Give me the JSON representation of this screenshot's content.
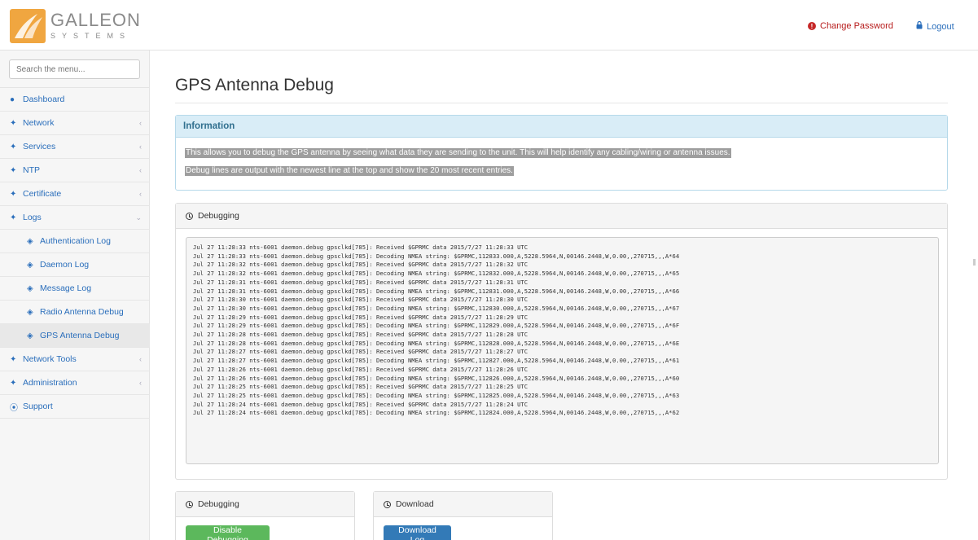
{
  "header": {
    "logo_name": "GALLEON",
    "logo_sub": "SYSTEMS",
    "change_password": "Change Password",
    "logout": "Logout",
    "brand_colors": {
      "logo_orange": "#f0a640",
      "link_blue": "#2a6ebb",
      "alert_red": "#c62828"
    }
  },
  "sidebar": {
    "search_placeholder": "Search the menu...",
    "items": [
      {
        "label": "Dashboard",
        "icon": "dashboard-icon"
      },
      {
        "label": "Network",
        "icon": "wrench-icon"
      },
      {
        "label": "Services",
        "icon": "wrench-icon"
      },
      {
        "label": "NTP",
        "icon": "wrench-icon"
      },
      {
        "label": "Certificate",
        "icon": "wrench-icon"
      },
      {
        "label": "Logs",
        "icon": "wrench-icon"
      },
      {
        "label": "Authentication Log",
        "icon": "cube-icon"
      },
      {
        "label": "Daemon Log",
        "icon": "cube-icon"
      },
      {
        "label": "Message Log",
        "icon": "cube-icon"
      },
      {
        "label": "Radio Antenna Debug",
        "icon": "cube-icon"
      },
      {
        "label": "GPS Antenna Debug",
        "icon": "cube-icon"
      },
      {
        "label": "Network Tools",
        "icon": "wrench-icon"
      },
      {
        "label": "Administration",
        "icon": "wrench-icon"
      },
      {
        "label": "Support",
        "icon": "lifebuoy-icon"
      }
    ]
  },
  "main": {
    "title": "GPS Antenna Debug",
    "info": {
      "heading": "Information",
      "line1": "This allows you to debug the GPS antenna by seeing what data they are sending to the unit. This will help identify any cabling/wiring or antenna issues.",
      "line2": "Debug lines are output with the newest line at the top and show the 20 most recent entries."
    },
    "debugging_heading": "Debugging",
    "log_lines": [
      "Jul 27 11:28:33 nts-6001 daemon.debug gpsclkd[785]: Received $GPRMC data 2015/7/27 11:28:33 UTC",
      "Jul 27 11:28:33 nts-6001 daemon.debug gpsclkd[785]: Decoding NMEA string: $GPRMC,112833.000,A,5228.5964,N,00146.2448,W,0.00,,270715,,,A*64",
      "Jul 27 11:28:32 nts-6001 daemon.debug gpsclkd[785]: Received $GPRMC data 2015/7/27 11:28:32 UTC",
      "Jul 27 11:28:32 nts-6001 daemon.debug gpsclkd[785]: Decoding NMEA string: $GPRMC,112832.000,A,5228.5964,N,00146.2448,W,0.00,,270715,,,A*65",
      "Jul 27 11:28:31 nts-6001 daemon.debug gpsclkd[785]: Received $GPRMC data 2015/7/27 11:28:31 UTC",
      "Jul 27 11:28:31 nts-6001 daemon.debug gpsclkd[785]: Decoding NMEA string: $GPRMC,112831.000,A,5228.5964,N,00146.2448,W,0.00,,270715,,,A*66",
      "Jul 27 11:28:30 nts-6001 daemon.debug gpsclkd[785]: Received $GPRMC data 2015/7/27 11:28:30 UTC",
      "Jul 27 11:28:30 nts-6001 daemon.debug gpsclkd[785]: Decoding NMEA string: $GPRMC,112830.000,A,5228.5964,N,00146.2448,W,0.00,,270715,,,A*67",
      "Jul 27 11:28:29 nts-6001 daemon.debug gpsclkd[785]: Received $GPRMC data 2015/7/27 11:28:29 UTC",
      "Jul 27 11:28:29 nts-6001 daemon.debug gpsclkd[785]: Decoding NMEA string: $GPRMC,112829.000,A,5228.5964,N,00146.2448,W,0.00,,270715,,,A*6F",
      "Jul 27 11:28:28 nts-6001 daemon.debug gpsclkd[785]: Received $GPRMC data 2015/7/27 11:28:28 UTC",
      "Jul 27 11:28:28 nts-6001 daemon.debug gpsclkd[785]: Decoding NMEA string: $GPRMC,112828.000,A,5228.5964,N,00146.2448,W,0.00,,270715,,,A*6E",
      "Jul 27 11:28:27 nts-6001 daemon.debug gpsclkd[785]: Received $GPRMC data 2015/7/27 11:28:27 UTC",
      "Jul 27 11:28:27 nts-6001 daemon.debug gpsclkd[785]: Decoding NMEA string: $GPRMC,112827.000,A,5228.5964,N,00146.2448,W,0.00,,270715,,,A*61",
      "Jul 27 11:28:26 nts-6001 daemon.debug gpsclkd[785]: Received $GPRMC data 2015/7/27 11:28:26 UTC",
      "Jul 27 11:28:26 nts-6001 daemon.debug gpsclkd[785]: Decoding NMEA string: $GPRMC,112826.000,A,5228.5964,N,00146.2448,W,0.00,,270715,,,A*60",
      "Jul 27 11:28:25 nts-6001 daemon.debug gpsclkd[785]: Received $GPRMC data 2015/7/27 11:28:25 UTC",
      "Jul 27 11:28:25 nts-6001 daemon.debug gpsclkd[785]: Decoding NMEA string: $GPRMC,112825.000,A,5228.5964,N,00146.2448,W,0.00,,270715,,,A*63",
      "Jul 27 11:28:24 nts-6001 daemon.debug gpsclkd[785]: Received $GPRMC data 2015/7/27 11:28:24 UTC",
      "Jul 27 11:28:24 nts-6001 daemon.debug gpsclkd[785]: Decoding NMEA string: $GPRMC,112824.000,A,5228.5964,N,00146.2448,W,0.00,,270715,,,A*62"
    ],
    "debug_box": {
      "heading": "Debugging",
      "button": "Disable Debugging"
    },
    "download_box": {
      "heading": "Download",
      "button": "Download Log"
    }
  }
}
